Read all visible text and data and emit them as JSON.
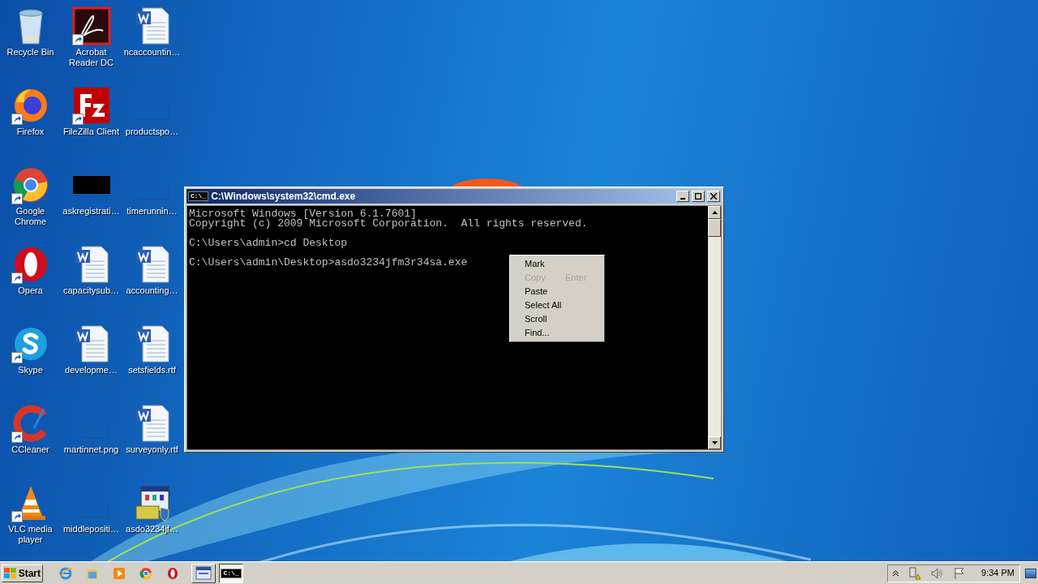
{
  "desktop": {
    "columns": [
      [
        {
          "label": "Recycle Bin",
          "kind": "recycle",
          "shortcut": false
        },
        {
          "label": "Firefox",
          "kind": "firefox",
          "shortcut": true
        },
        {
          "label": "Google Chrome",
          "kind": "chrome",
          "shortcut": true
        },
        {
          "label": "Opera",
          "kind": "opera",
          "shortcut": true
        },
        {
          "label": "Skype",
          "kind": "skype",
          "shortcut": true
        },
        {
          "label": "CCleaner",
          "kind": "ccleaner",
          "shortcut": true
        },
        {
          "label": "VLC media player",
          "kind": "vlc",
          "shortcut": true
        }
      ],
      [
        {
          "label": "Acrobat Reader DC",
          "kind": "acrobat",
          "shortcut": true
        },
        {
          "label": "FileZilla Client",
          "kind": "filezilla",
          "shortcut": true
        },
        {
          "label": "askregistrati…",
          "kind": "black",
          "shortcut": false
        },
        {
          "label": "capacitysub…",
          "kind": "word",
          "shortcut": false
        },
        {
          "label": "developme…",
          "kind": "word",
          "shortcut": false
        },
        {
          "label": "martinnet.png",
          "kind": "blank",
          "shortcut": false
        },
        {
          "label": "middlepositi…",
          "kind": "blank",
          "shortcut": false
        }
      ],
      [
        {
          "label": "ncaccountin…",
          "kind": "word",
          "shortcut": false
        },
        {
          "label": "productspo…",
          "kind": "blank",
          "shortcut": false
        },
        {
          "label": "timerunnin…",
          "kind": "blank",
          "shortcut": false
        },
        {
          "label": "accounting…",
          "kind": "word",
          "shortcut": false
        },
        {
          "label": "setsfields.rtf",
          "kind": "word",
          "shortcut": false
        },
        {
          "label": "surveyonly.rtf",
          "kind": "word",
          "shortcut": false
        },
        {
          "label": "asdo3234jf…",
          "kind": "installer",
          "shortcut": false
        }
      ]
    ]
  },
  "cmd_window": {
    "title": "C:\\Windows\\system32\\cmd.exe",
    "icon_text": "C:\\_",
    "output_blocks": [
      [
        "Microsoft Windows [Version 6.1.7601]",
        "Copyright (c) 2009 Microsoft Corporation.  All rights reserved."
      ],
      [
        "C:\\Users\\admin>cd Desktop"
      ],
      [
        "C:\\Users\\admin\\Desktop>asdo3234jfm3r34sa.exe"
      ]
    ]
  },
  "context_menu": [
    {
      "label": "Mark",
      "disabled": false
    },
    {
      "label": "Copy",
      "shortcut": "Enter",
      "disabled": true
    },
    {
      "label": "Paste",
      "disabled": false
    },
    {
      "label": "Select All",
      "disabled": false
    },
    {
      "label": "Scroll",
      "disabled": false
    },
    {
      "label": "Find...",
      "disabled": false
    }
  ],
  "taskbar": {
    "start": "Start",
    "quick_launch": [
      {
        "kind": "ie"
      },
      {
        "kind": "folder"
      },
      {
        "kind": "media"
      },
      {
        "kind": "chrome"
      },
      {
        "kind": "opera"
      }
    ],
    "tasks": [
      {
        "kind": "installer",
        "selected": false
      },
      {
        "kind": "cmd",
        "selected": true,
        "icon_text": "C:\\_"
      }
    ],
    "clock": "9:34 PM"
  }
}
